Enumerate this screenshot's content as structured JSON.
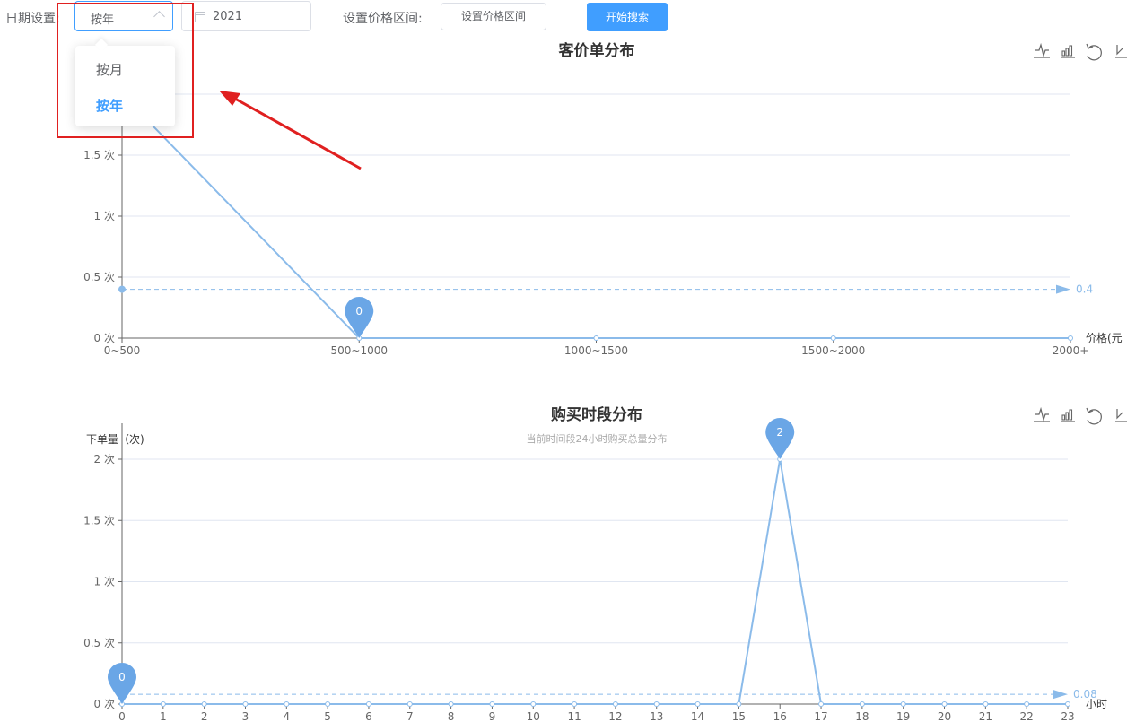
{
  "filters": {
    "date_label": "日期设置:",
    "mode_selected": "按年",
    "mode_options": [
      "按月",
      "按年"
    ],
    "mode_options_active_index": 1,
    "year_value": "2021",
    "price_range_label": "设置价格区间:",
    "price_range_button": "设置价格区间",
    "search_button": "开始搜索"
  },
  "colors": {
    "accent": "#409eff",
    "series": "#8bbbea",
    "pin": "#6aa6e6",
    "annotation": "#e02020"
  },
  "toolbox_icons": [
    "line-chart-icon",
    "bar-chart-icon",
    "restore-icon",
    "download-icon"
  ],
  "chart_data": [
    {
      "type": "line",
      "title": "客价单分布",
      "subtitle": "",
      "ylabel": "",
      "xlabel": "价格(元",
      "categories": [
        "0~500",
        "500~1000",
        "1000~1500",
        "1500~2000",
        "2000+"
      ],
      "y_ticks": [
        "0 次",
        "0.5 次",
        "1 次",
        "1.5 次"
      ],
      "ylim": [
        0,
        2
      ],
      "series": [
        {
          "values": [
            2,
            0,
            0,
            0,
            0
          ]
        }
      ],
      "mark_point": {
        "label": "0",
        "category": "500~1000",
        "value": 0
      },
      "mark_line": {
        "label": "0.4",
        "value": 0.4
      }
    },
    {
      "type": "line",
      "title": "购买时段分布",
      "subtitle": "当前时间段24小时购买总量分布",
      "ylabel": "下单量（次)",
      "xlabel": "小时",
      "categories": [
        "0",
        "1",
        "2",
        "3",
        "4",
        "5",
        "6",
        "7",
        "8",
        "9",
        "10",
        "11",
        "12",
        "13",
        "14",
        "15",
        "16",
        "17",
        "18",
        "19",
        "20",
        "21",
        "22",
        "23"
      ],
      "y_ticks": [
        "0 次",
        "0.5 次",
        "1 次",
        "1.5 次",
        "2 次"
      ],
      "ylim": [
        0,
        2
      ],
      "series": [
        {
          "values": [
            0,
            0,
            0,
            0,
            0,
            0,
            0,
            0,
            0,
            0,
            0,
            0,
            0,
            0,
            0,
            0,
            2,
            0,
            0,
            0,
            0,
            0,
            0,
            0
          ]
        }
      ],
      "mark_points": [
        {
          "label": "2",
          "category": "16",
          "value": 2
        },
        {
          "label": "0",
          "category": "0",
          "value": 0
        }
      ],
      "mark_line": {
        "label": "0.08",
        "value": 0.08
      }
    }
  ]
}
